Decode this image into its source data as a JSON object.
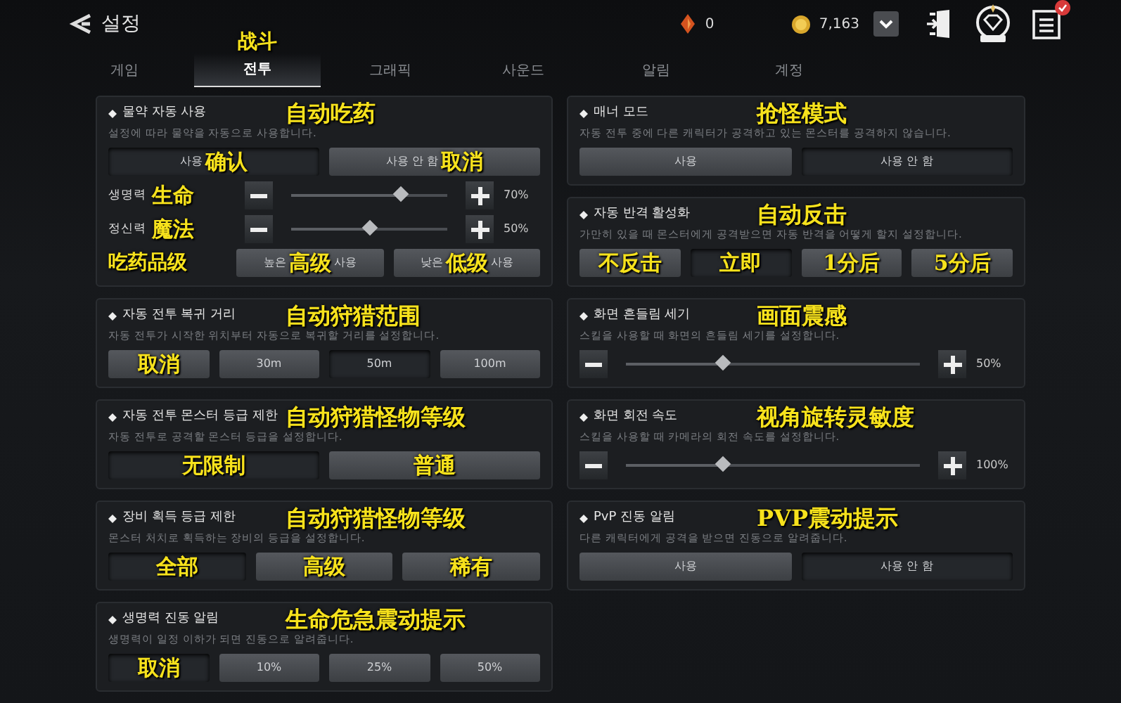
{
  "header": {
    "title": "설정",
    "currencies": [
      {
        "kind": "gem",
        "amount": "0"
      },
      {
        "kind": "gold",
        "amount": "7,163"
      }
    ]
  },
  "tabs": [
    {
      "label": "게임",
      "selected": false
    },
    {
      "label": "전투",
      "selected": true,
      "note": "战斗"
    },
    {
      "label": "그래픽",
      "selected": false
    },
    {
      "label": "사운드",
      "selected": false
    },
    {
      "label": "알림",
      "selected": false
    },
    {
      "label": "계정",
      "selected": false
    }
  ],
  "left_cards": [
    {
      "title": "물약 자동 사용",
      "note": "自动吃药",
      "description": "설정에 따라 물약을 자동으로 사용합니다.",
      "rows": [
        {
          "kind": "buttons",
          "buttons": [
            {
              "label": "사용",
              "note": "确认",
              "selected": true
            },
            {
              "label": "사용 안 함",
              "note": "取消",
              "selected": false
            }
          ]
        },
        {
          "kind": "slider",
          "label": "생명력",
          "note": "生命",
          "level": 0.7,
          "reading": "70%"
        },
        {
          "kind": "slider",
          "label": "정신력",
          "note": "魔法",
          "level": 0.5,
          "reading": "50%"
        },
        {
          "kind": "labeled_buttons",
          "note": "吃药品级",
          "buttons": [
            {
              "label": "높은",
              "note": "高级",
              "suffix": "사용",
              "selected": false
            },
            {
              "label": "낮은",
              "note": "低级",
              "suffix": "사용",
              "selected": false
            }
          ]
        }
      ]
    },
    {
      "title": "자동 전투 복귀 거리",
      "note": "自动狩猎范围",
      "description": "자동 전투가 시작한 위치부터 자동으로 복귀할 거리를 설정합니다.",
      "rows": [
        {
          "kind": "buttons",
          "buttons": [
            {
              "note": "取消",
              "selected": false
            },
            {
              "label": "30m",
              "selected": false
            },
            {
              "label": "50m",
              "selected": true
            },
            {
              "label": "100m",
              "selected": false
            }
          ]
        }
      ]
    },
    {
      "title": "자동 전투 몬스터 등급 제한",
      "note": "自动狩猎怪物等级",
      "description": "자동 전투로 공격할 몬스터 등급을 설정합니다.",
      "rows": [
        {
          "kind": "buttons",
          "buttons": [
            {
              "note": "无限制",
              "selected": true
            },
            {
              "note": "普通",
              "selected": false
            }
          ]
        }
      ]
    },
    {
      "title": "장비 획득 등급 제한",
      "note": "自动狩猎怪物等级",
      "description": "몬스터 처치로 획득하는 장비의 등급을 설정합니다.",
      "rows": [
        {
          "kind": "buttons",
          "buttons": [
            {
              "note": "全部",
              "selected": true
            },
            {
              "note": "高级",
              "selected": false
            },
            {
              "note": "稀有",
              "selected": false
            }
          ]
        }
      ]
    },
    {
      "title": "생명력 진동 알림",
      "note": "生命危急震动提示",
      "description": "생명력이 일정 이하가 되면 진동으로 알려줍니다.",
      "rows": [
        {
          "kind": "buttons",
          "buttons": [
            {
              "note": "取消",
              "selected": true
            },
            {
              "label": "10%",
              "selected": false
            },
            {
              "label": "25%",
              "selected": false
            },
            {
              "label": "50%",
              "selected": false
            }
          ]
        }
      ]
    }
  ],
  "right_cards": [
    {
      "title": "매너 모드",
      "note": "抢怪模式",
      "description": "자동 전투 중에 다른 캐릭터가 공격하고 있는 몬스터를 공격하지 않습니다.",
      "rows": [
        {
          "kind": "buttons",
          "buttons": [
            {
              "label": "사용",
              "selected": false
            },
            {
              "label": "사용 안 함",
              "selected": true
            }
          ]
        }
      ]
    },
    {
      "title": "자동 반격 활성화",
      "note": "自动反击",
      "description": "가만히 있을 때 몬스터에게 공격받으면 자동 반격을 어떻게 할지 설정합니다.",
      "rows": [
        {
          "kind": "buttons",
          "buttons": [
            {
              "note": "不反击",
              "selected": false
            },
            {
              "note": "立即",
              "selected": true
            },
            {
              "note": "1分后",
              "selected": false
            },
            {
              "note": "5分后",
              "selected": false
            }
          ]
        }
      ]
    },
    {
      "title": "화면 흔들림 세기",
      "note": "画面震感",
      "description": "스킬을 사용할 때 화면의 흔들림 세기를 설정합니다.",
      "rows": [
        {
          "kind": "slider",
          "level": 0.33,
          "reading": "50%"
        }
      ]
    },
    {
      "title": "화면 회전 속도",
      "note": "视角旋转灵敏度",
      "description": "스킬을 사용할 때 카메라의 회전 속도를 설정합니다.",
      "rows": [
        {
          "kind": "slider",
          "level": 0.33,
          "reading": "100%"
        }
      ]
    },
    {
      "title": "PvP 진동 알림",
      "note": "PVP震动提示",
      "description": "다른 캐릭터에게 공격을 받으면 진동으로 알려줍니다.",
      "rows": [
        {
          "kind": "buttons",
          "buttons": [
            {
              "label": "사용",
              "selected": false
            },
            {
              "label": "사용 안 함",
              "selected": true
            }
          ]
        }
      ]
    }
  ]
}
